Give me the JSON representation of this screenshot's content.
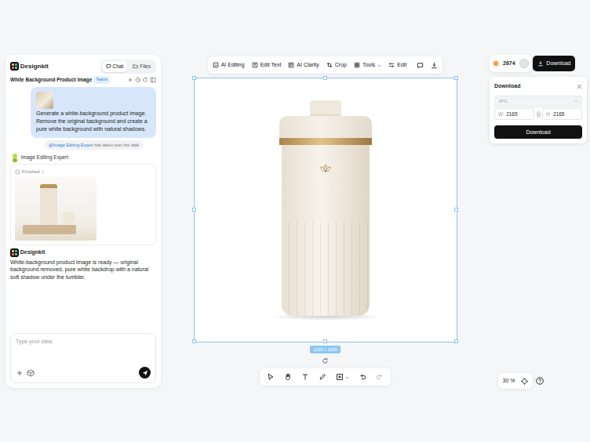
{
  "app": {
    "name": "Designkit"
  },
  "panel_tabs": [
    {
      "label": "Chat",
      "selected": true
    },
    {
      "label": "Files",
      "selected": false
    }
  ],
  "project": {
    "title": "White Background Product Image",
    "badge": "Teams"
  },
  "chat": {
    "user_message": "Generate a white-background product image. Remove the original background and create a pure white background with natural shadows.",
    "handoff": {
      "mention": "@Image Editing Expert",
      "text": "has taken over the task"
    },
    "agent": {
      "name": "Image Editing Expert",
      "status": "Finished"
    },
    "reply": {
      "sender": "Designkit",
      "text": "White-background product image is ready — original background removed, pure white backdrop with a natural soft shadow under the tumbler."
    }
  },
  "input": {
    "placeholder": "Type your idea."
  },
  "toolbar": [
    {
      "label": "AI Editing",
      "kind": "button"
    },
    {
      "label": "Edit Text",
      "kind": "button"
    },
    {
      "label": "AI Clarity",
      "kind": "button"
    },
    {
      "label": "Crop",
      "kind": "button"
    },
    {
      "label": "Tools",
      "kind": "dropdown"
    },
    {
      "label": "Edit",
      "kind": "button"
    }
  ],
  "canvas": {
    "size_label": "2165 x 2165"
  },
  "zoom": {
    "value": "30",
    "unit": "%"
  },
  "credits": "2674",
  "download_button": "Download",
  "download_panel": {
    "title": "Download",
    "format": "JPG",
    "format_disabled": true,
    "width_label": "W",
    "width": "2165",
    "height_label": "H",
    "height": "2165",
    "button": "Download"
  }
}
